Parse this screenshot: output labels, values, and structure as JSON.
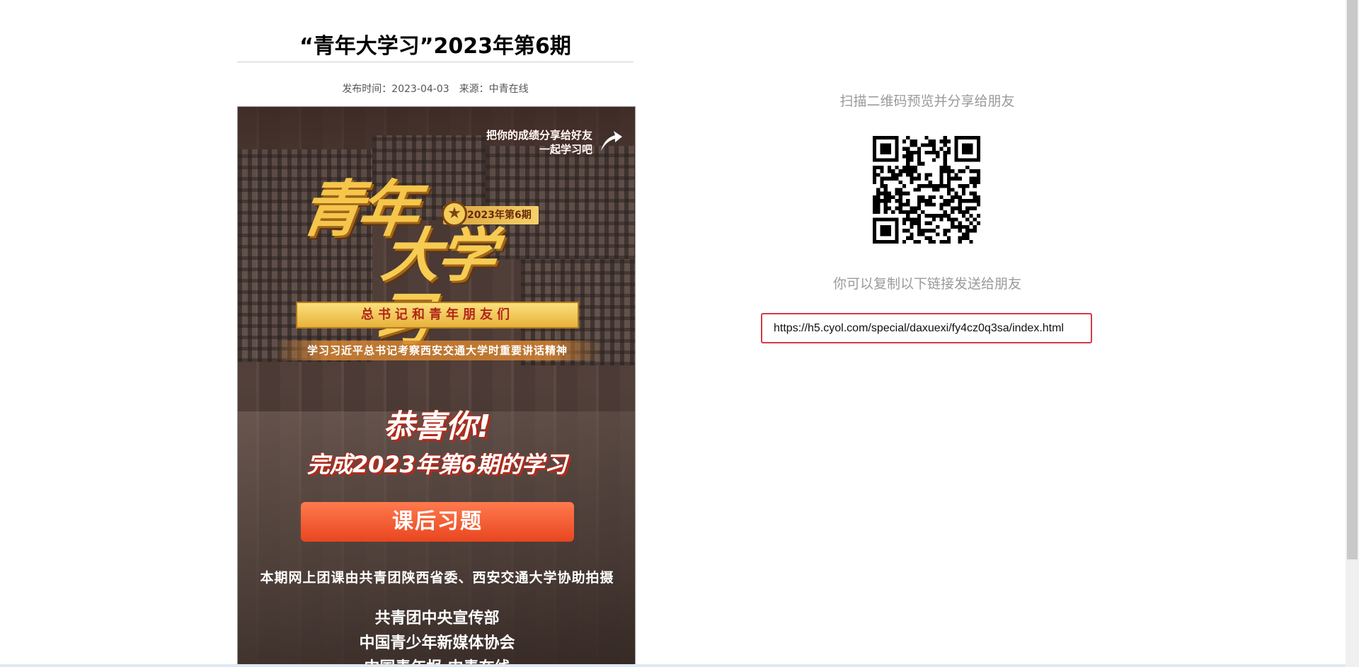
{
  "article": {
    "title": "“青年大学习”2023年第6期",
    "publish_label": "发布时间：2023-04-03",
    "source_label": "来源：中青在线"
  },
  "poster": {
    "share_tip_line1": "把你的成绩分享给好友",
    "share_tip_line2": "一起学习吧",
    "logo_line1": "青年",
    "logo_line2": "大学习",
    "issue_tag": "2023年第6期",
    "banner": "总书记和青年朋友们",
    "banner_sub": "学习习近平总书记考察西安交通大学时重要讲话精神",
    "congrats": "恭喜你!",
    "complete": "完成2023年第6期的学习",
    "cta_label": "课后习题",
    "credit": "本期网上团课由共青团陕西省委、西安交通大学协助拍摄",
    "orgs": [
      "共青团中央宣传部",
      "中国青少年新媒体协会",
      "中国青年报·中青在线"
    ]
  },
  "share": {
    "qr_title": "扫描二维码预览并分享给朋友",
    "link_hint": "你可以复制以下链接发送给朋友",
    "link_value": "https://h5.cyol.com/special/daxuexi/fy4cz0q3sa/index.html"
  },
  "colors": {
    "accent_red": "#d33a47",
    "cta_orange": "#e8461f",
    "gold": "#f5c64a"
  }
}
